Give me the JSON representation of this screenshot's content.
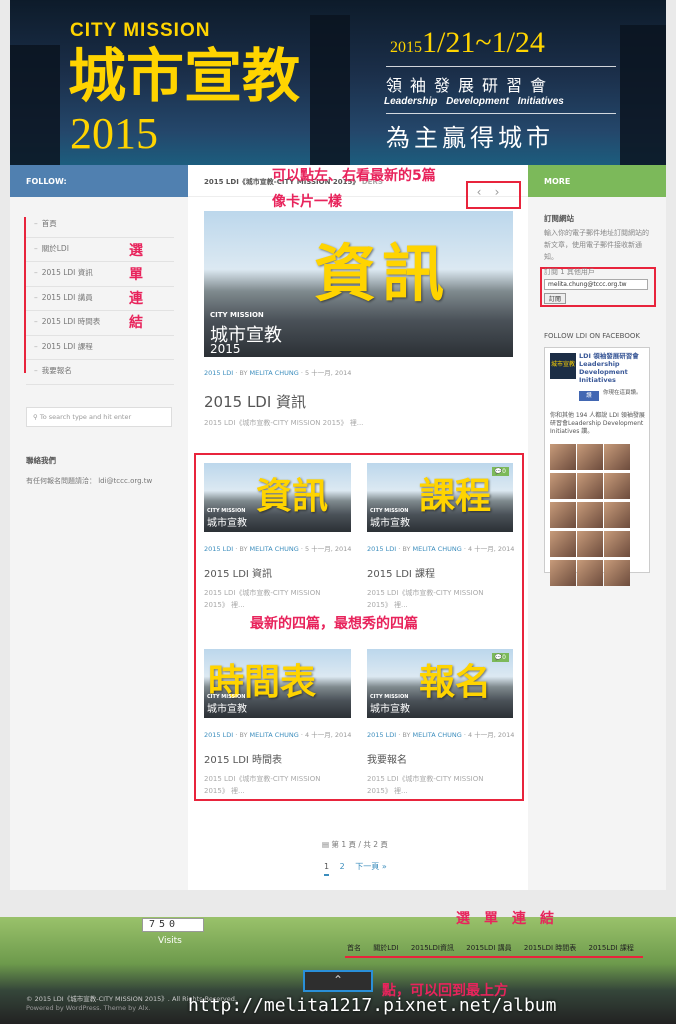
{
  "banner": {
    "city_mission": "CITY MISSION",
    "title_cn": "城市宣教",
    "year": "2015",
    "dates_year": "2015",
    "dates": "1/21~1/24",
    "ldi_cn": "領袖發展研習會",
    "ldi_en": "Leadership Development Initiatives",
    "motto": "為主贏得城市"
  },
  "top_bars": {
    "follow": "FOLLOW:",
    "more": "MORE"
  },
  "sidebar": {
    "menu": [
      "首頁",
      "關於LDI",
      "2015 LDI 資訊",
      "2015 LDI 講員",
      "2015 LDI 時間表",
      "2015 LDI 課程",
      "我要報名"
    ],
    "search_placeholder": "To search type and hit enter",
    "contact_title": "聯絡我們",
    "contact_text": "有任何報名問題請洽： ldi@tccc.org.tw"
  },
  "annotations": {
    "slider_hint": "可以點左、右看最新的5篇",
    "slider_hint2": "像卡片一樣",
    "menu_links": [
      "選",
      "單",
      "連",
      "結"
    ],
    "latest_four": "最新的四篇，最想秀的四篇",
    "footer_links": "選　單　連　結",
    "to_top": "點，可以回到最上方"
  },
  "featured": {
    "breadcrumb": "2015 LDI《城市宣教-CITY MISSION 2015》",
    "breadcrumb_tail": "DERS",
    "image_word": "資訊",
    "image_cm": "CITY MISSION",
    "image_cn": "城市宣教",
    "image_year": "2015",
    "category": "2015 LDI",
    "by": "BY",
    "author": "MELITA CHUNG",
    "date": "5 十一月, 2014",
    "title": "2015 LDI 資訊",
    "excerpt": "2015 LDI《城市宣教-CITY MISSION 2015》 裡..."
  },
  "posts": [
    {
      "word": "資訊",
      "badge": "",
      "category": "2015 LDI",
      "author": "MELITA CHUNG",
      "date": "5 十一月, 2014",
      "title": "2015 LDI 資訊",
      "excerpt1": "2015 LDI《城市宣教-CITY MISSION",
      "excerpt2": "2015》 裡..."
    },
    {
      "word": "課程",
      "badge": "0",
      "category": "2015 LDI",
      "author": "MELITA CHUNG",
      "date": "4 十一月, 2014",
      "title": "2015 LDI 課程",
      "excerpt1": "2015 LDI《城市宣教-CITY MISSION",
      "excerpt2": "2015》 裡..."
    },
    {
      "word": "時間表",
      "badge": "",
      "category": "2015 LDI",
      "author": "MELITA CHUNG",
      "date": "4 十一月, 2014",
      "title": "2015 LDI 時間表",
      "excerpt1": "2015 LDI《城市宣教-CITY MISSION",
      "excerpt2": "2015》 裡..."
    },
    {
      "word": "報名",
      "badge": "0",
      "category": "2015 LDI",
      "author": "MELITA CHUNG",
      "date": "4 十一月, 2014",
      "title": "我要報名",
      "excerpt1": "2015 LDI《城市宣教-CITY MISSION",
      "excerpt2": "2015》 裡..."
    }
  ],
  "pagination": {
    "info": "第 1 頁 / 共 2 頁",
    "p1": "1",
    "p2": "2",
    "next": "下一頁 »"
  },
  "right": {
    "sub_title": "訂閱網站",
    "sub_text": "輸入你的電子郵件地址訂閱網站的新文章，使用電子郵件接收新通知。",
    "sub_label": "訂閱 1 其他用戶",
    "sub_value": "melita.chung@tccc.org.tw",
    "sub_button": "訂閱",
    "fb_title": "FOLLOW LDI ON FACEBOOK",
    "fb_logo_cn": "城市宣教",
    "fb_name": "LDI 領袖發展研習會Leadership Development Initiatives",
    "fb_like": "讚",
    "fb_like_txt": "你現在這頁讚。",
    "fb_count": "你和其他 194 人都說 LDI 領袖發展研習會Leadership Development Initiatives 讚。"
  },
  "footer": {
    "counter": "750",
    "visits": "Visits",
    "nav": [
      "首名",
      "關於LDI",
      "2015LDI資訊",
      "2015LDI 講員",
      "2015LDI 時間表",
      "2015LDI 課程"
    ],
    "copyright": "© 2015 LDI《城市宣教-CITY MISSION 2015》. All Rights Reserved.",
    "powered": "Powered by WordPress. Theme by Alx.",
    "watermark": "http://melita1217.pixnet.net/album"
  },
  "colors": {
    "accent_blue": "#3b8dbd",
    "follow_bar": "#5080b0",
    "more_bar": "#7cb95a",
    "annotation": "#e8245c",
    "banner_yellow": "#ffd400"
  }
}
